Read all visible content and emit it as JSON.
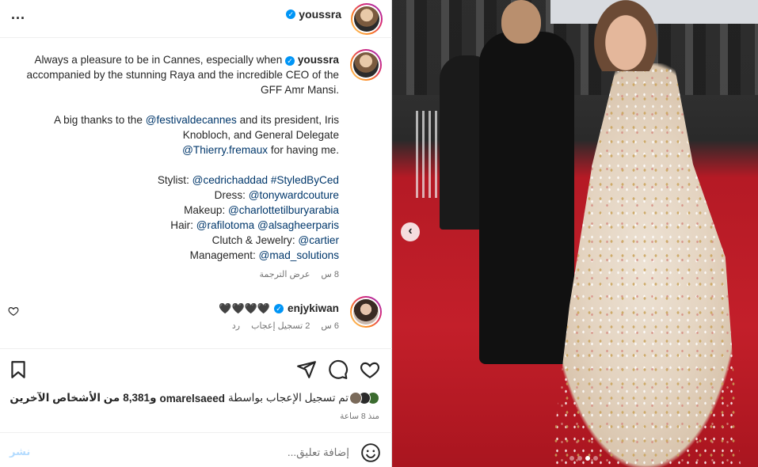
{
  "header": {
    "username": "youssra",
    "more_label": "..."
  },
  "caption": {
    "line1_pre": "Always a pleasure to be in Cannes, especially when",
    "line1_user": "youssra",
    "line2": "accompanied by the stunning Raya and the incredible CEO of the",
    "line3": "GFF Amr Mansi.",
    "line4_pre": "A big thanks to the",
    "line4_mention": "@festivaldecannes",
    "line4_post": "and its president, Iris",
    "line5": "Knobloch, and General Delegate",
    "line6_mention": "@Thierry.fremaux",
    "line6_post": "for having me.",
    "credits": [
      {
        "label": "Stylist:",
        "mentions": [
          "@cedrichaddad",
          "#StyledByCed"
        ]
      },
      {
        "label": "Dress:",
        "mentions": [
          "@tonywardcouture"
        ]
      },
      {
        "label": "Makeup:",
        "mentions": [
          "@charlottetilburyarabia"
        ]
      },
      {
        "label": "Hair:",
        "mentions": [
          "@rafilotoma",
          "@alsagheerparis"
        ]
      },
      {
        "label": "Clutch & Jewelry:",
        "mentions": [
          "@cartier"
        ]
      },
      {
        "label": "Management:",
        "mentions": [
          "@mad_solutions"
        ]
      }
    ],
    "time": "8 س",
    "see_translation": "عرض الترجمة"
  },
  "comment": {
    "username": "enjykiwan",
    "text": "🖤🖤🖤🖤",
    "time": "6 س",
    "likes": "2 تسجيل إعجاب",
    "reply": "رد"
  },
  "likes": {
    "prefix": "تم تسجيل الإعجاب بواسطة",
    "user": "omarelsaeed",
    "and": "و",
    "count": "8,381",
    "suffix": "من الأشخاص الآخرين"
  },
  "post_time": "منذ 8 ساعة",
  "add_comment": {
    "placeholder": "إضافة تعليق...",
    "post_label": "نشر"
  },
  "carousel": {
    "slide_count": 4,
    "active_index": 2
  },
  "colors": {
    "link": "#00376b",
    "verified": "#0095f6",
    "secondary_text": "#737373",
    "post_button_disabled": "#b3dbff"
  }
}
